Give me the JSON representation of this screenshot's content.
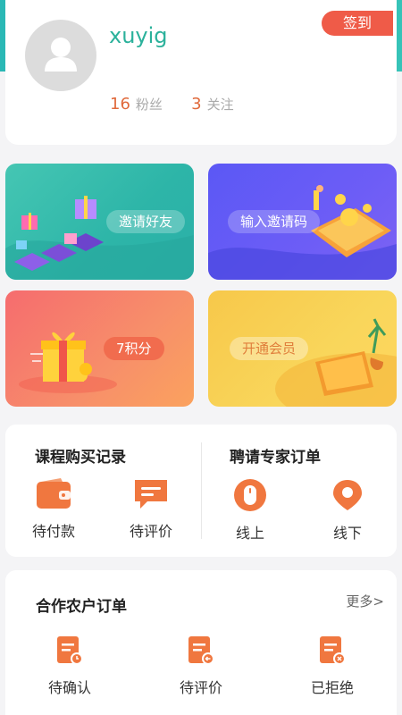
{
  "profile": {
    "username": "xuyig",
    "fans_count": "16",
    "fans_label": "粉丝",
    "following_count": "3",
    "following_label": "关注",
    "checkin_label": "签到"
  },
  "banners": {
    "invite_friends": "邀请好友",
    "enter_invite_code": "输入邀请码",
    "points": "7积分",
    "open_membership": "开通会员"
  },
  "purchases": {
    "course_title": "课程购买记录",
    "course_actions": [
      "待付款",
      "待评价"
    ],
    "expert_title": "聘请专家订单",
    "expert_actions": [
      "线上",
      "线下"
    ]
  },
  "coop": {
    "title": "合作农户订单",
    "more_label": "更多>",
    "actions": [
      "待确认",
      "待评价",
      "已拒绝"
    ]
  },
  "colors": {
    "accent_teal": "#2bb19b",
    "accent_orange": "#f0773f",
    "checkin_red": "#ef5b48"
  }
}
